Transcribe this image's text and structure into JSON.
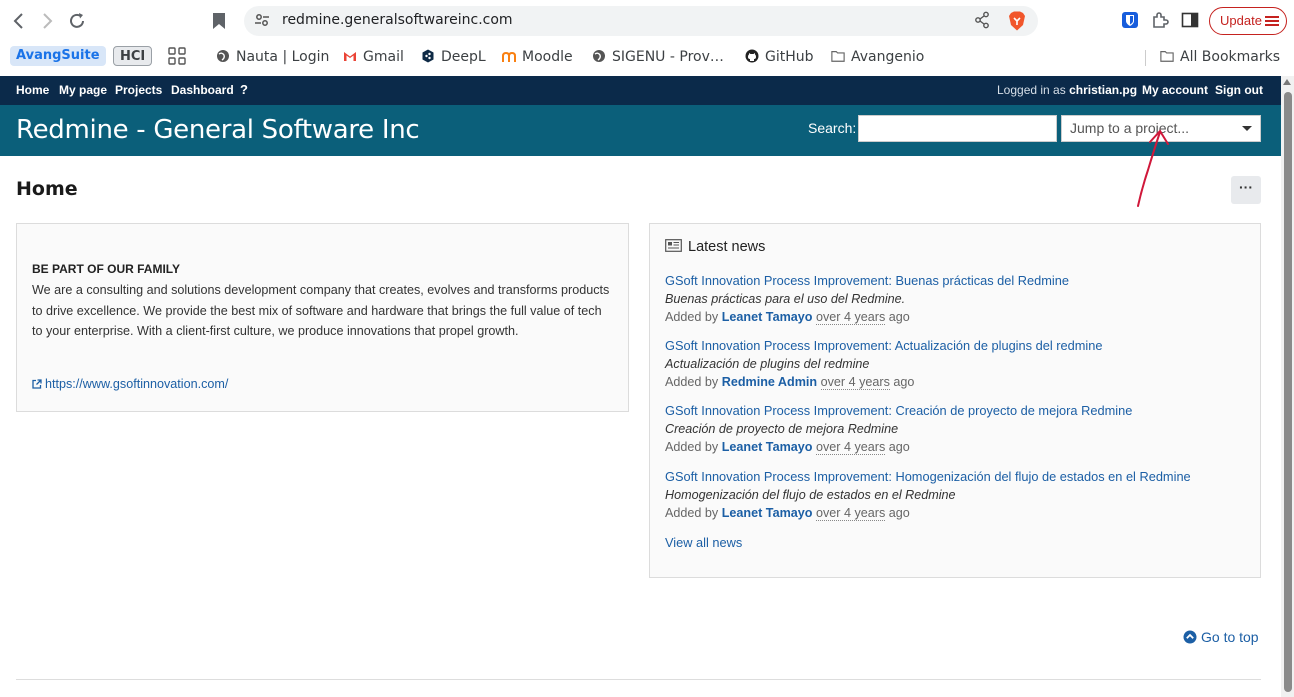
{
  "browser": {
    "url": "redmine.generalsoftwareinc.com",
    "update_label": "Update",
    "bookmarks": {
      "chip1": "AvangSuite",
      "chip2": "HCI",
      "nauta": "Nauta | Login",
      "gmail": "Gmail",
      "deepl": "DeepL",
      "moodle": "Moodle",
      "sigenu": "SIGENU - Prov…",
      "github": "GitHub",
      "avangenio": "Avangenio",
      "all": "All Bookmarks"
    }
  },
  "top_menu": {
    "home": "Home",
    "my_page": "My page",
    "projects": "Projects",
    "dashboard": "Dashboard",
    "help": "?",
    "logged_in_prefix": "Logged in as",
    "user": "christian.pg",
    "my_account": "My account",
    "sign_out": "Sign out"
  },
  "header": {
    "title": "Redmine - General Software Inc",
    "search_label": "Search:",
    "search_value": "",
    "jump_placeholder": "Jump to a project..."
  },
  "page": {
    "title": "Home",
    "more_label": "···"
  },
  "family": {
    "title": "BE PART OF OUR FAMILY",
    "text": "We are a consulting and solutions development company that creates, evolves and transforms products to drive excellence. We provide the best mix of software and hardware that brings the full value of tech to your enterprise. With a client-first culture, we produce innovations that propel growth.",
    "link": "https://www.gsoftinnovation.com/"
  },
  "news": {
    "title": "Latest news",
    "added_by": "Added by",
    "ago_suffix": "ago",
    "items": [
      {
        "title": "GSoft Innovation Process Improvement: Buenas prácticas del Redmine",
        "desc": "Buenas prácticas para el uso del Redmine.",
        "author": "Leanet Tamayo",
        "age": "over 4 years"
      },
      {
        "title": "GSoft Innovation Process Improvement: Actualización de plugins del redmine",
        "desc": "Actualización de plugins del redmine",
        "author": "Redmine Admin",
        "age": "over 4 years"
      },
      {
        "title": "GSoft Innovation Process Improvement: Creación de proyecto de mejora Redmine",
        "desc": "Creación de proyecto de mejora Redmine",
        "author": "Leanet Tamayo",
        "age": "over 4 years"
      },
      {
        "title": "GSoft Innovation Process Improvement: Homogenización del flujo de estados en el Redmine",
        "desc": "Homogenización del flujo de estados en el Redmine",
        "author": "Leanet Tamayo",
        "age": "over 4 years"
      }
    ],
    "view_all": "View all news"
  },
  "footer": {
    "go_to_top": "Go to top"
  },
  "colors": {
    "top_menu_bg": "#0b2a4a",
    "header_bg": "#0b5f7a",
    "link": "#1c5fa5",
    "annotation": "#d0183a"
  }
}
